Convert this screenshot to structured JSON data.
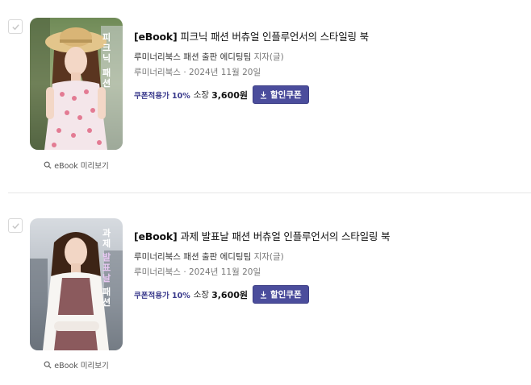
{
  "books": [
    {
      "tag": "[eBook]",
      "title": "피크닉 패션 버츄얼 인플루언서의 스타일링 북",
      "author": "루미너리북스 패션 출판 에디팅팀",
      "author_role": "지자(글)",
      "publisher": "루미너리북스",
      "separator": "·",
      "date": "2024년 11월 20일",
      "coupon_note": "쿠폰적용가 10%",
      "own_label": "소장",
      "price": "3,600원",
      "coupon_button": "할인쿠폰",
      "preview_label": "eBook 미리보기",
      "cover_text": "피크닉 패션"
    },
    {
      "tag": "[eBook]",
      "title": "과제 발표날 패션 버츄얼 인플루언서의 스타일링 북",
      "author": "루미너리북스 패션 출판 에디팅팀",
      "author_role": "지자(글)",
      "publisher": "루미너리북스",
      "separator": "·",
      "date": "2024년 11월 20일",
      "coupon_note": "쿠폰적용가 10%",
      "own_label": "소장",
      "price": "3,600원",
      "coupon_button": "할인쿠폰",
      "preview_label": "eBook 미리보기",
      "cover_text": "과제 발표날 패션"
    }
  ],
  "colors": {
    "coupon_button_bg": "#4b4d9c",
    "coupon_note": "#3a3a8c",
    "divider": "#e6e6e6"
  },
  "icons": {
    "checkbox": "check-icon",
    "preview": "search-icon",
    "coupon": "download-icon"
  }
}
